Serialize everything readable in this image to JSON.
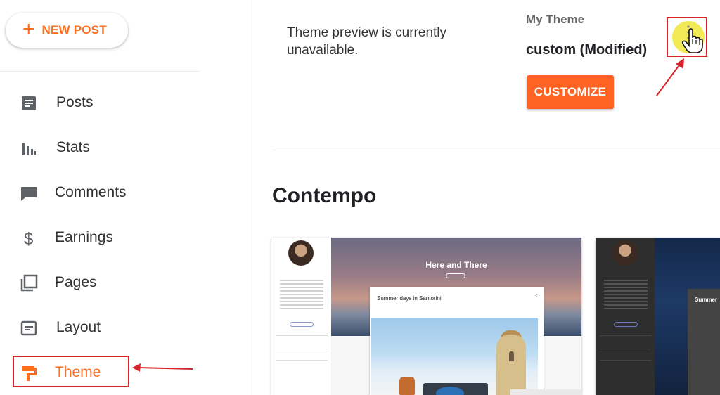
{
  "sidebar": {
    "new_post": {
      "icon": "plus-icon",
      "label": "NEW POST"
    },
    "items": [
      {
        "label": "Posts",
        "icon": "posts-icon"
      },
      {
        "label": "Stats",
        "icon": "stats-icon"
      },
      {
        "label": "Comments",
        "icon": "comments-icon"
      },
      {
        "label": "Earnings",
        "icon": "dollar-icon"
      },
      {
        "label": "Pages",
        "icon": "pages-icon"
      },
      {
        "label": "Layout",
        "icon": "layout-icon"
      },
      {
        "label": "Theme",
        "icon": "paint-roller-icon",
        "active": true
      }
    ]
  },
  "main": {
    "preview_message": "Theme preview is currently unavailable.",
    "my_theme": {
      "label": "My Theme",
      "name": "custom (Modified)",
      "customize_label": "CUSTOMIZE",
      "more_icon": "more-vert-icon"
    },
    "section_title": "Contempo",
    "cards": {
      "light": {
        "hero_title": "Here and There",
        "post_title": "Summer days in Santorini"
      },
      "dark": {
        "post_title": "Summer"
      }
    }
  },
  "colors": {
    "accent": "#ff6d1f",
    "customize_button": "#ff6323",
    "annotation_red": "#d9232a",
    "highlight_yellow": "#f2e956"
  }
}
